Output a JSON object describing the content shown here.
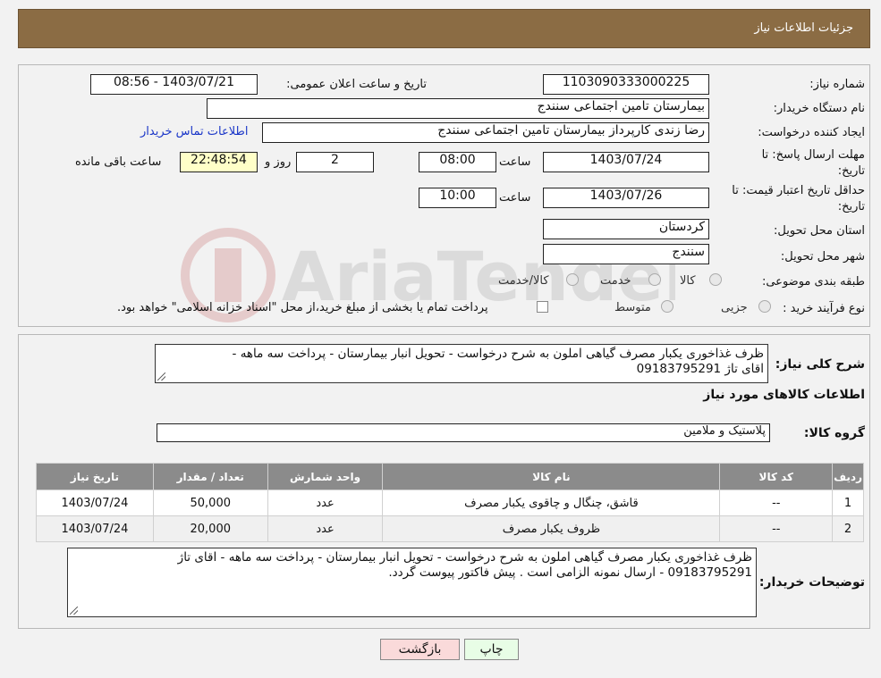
{
  "header": {
    "title": "جزئیات اطلاعات نیاز"
  },
  "form": {
    "need_number_label": "شماره نیاز:",
    "need_number": "1103090333000225",
    "announce_label": "تاریخ و ساعت اعلان عمومی:",
    "announce_value": "1403/07/21 - 08:56",
    "buyer_org_label": "نام دستگاه خریدار:",
    "buyer_org": "بیمارستان تامین اجتماعی سنندج",
    "creator_label": "ایجاد کننده درخواست:",
    "creator": "رضا زندی کارپرداز بیمارستان تامین اجتماعی سنندج",
    "contact_link": "اطلاعات تماس خریدار",
    "deadline_label_1": "مهلت ارسال پاسخ: تا",
    "deadline_label_2": "تاریخ:",
    "deadline_date": "1403/07/24",
    "time_word": "ساعت",
    "deadline_time": "08:00",
    "days_value": "2",
    "days_word": "روز و",
    "remaining_time": "22:48:54",
    "remaining_word": "ساعت باقی مانده",
    "validity_label_1": "حداقل تاریخ اعتبار قیمت: تا",
    "validity_label_2": "تاریخ:",
    "validity_date": "1403/07/26",
    "validity_time": "10:00",
    "province_label": "استان محل تحویل:",
    "province": "کردستان",
    "city_label": "شهر محل تحویل:",
    "city": "سنندج",
    "category_label": "طبقه بندی موضوعی:",
    "category_options": [
      "کالا",
      "خدمت",
      "کالا/خدمت"
    ],
    "process_label": "نوع فرآیند خرید :",
    "process_options": [
      "جزیی",
      "متوسط"
    ],
    "payment_note": "پرداخت تمام یا بخشی از مبلغ خرید،از محل \"اسناد خزانه اسلامی\" خواهد بود."
  },
  "summary": {
    "desc_label": "شرح کلی نیاز:",
    "desc_line1": "ظرف غذاخوری یکبار مصرف گیاهی املون  به شرح درخواست  - تحویل انبار بیمارستان - پرداخت سه ماهه -",
    "desc_line2": "اقای تاژ 09183795291",
    "goods_info_title": "اطلاعات کالاهای مورد نیاز",
    "goods_group_label": "گروه کالا:",
    "goods_group": "پلاستیک و ملامین"
  },
  "table": {
    "headers": [
      "ردیف",
      "کد کالا",
      "نام کالا",
      "واحد شمارش",
      "تعداد / مقدار",
      "تاریخ نیاز"
    ],
    "rows": [
      [
        "1",
        "--",
        "قاشق، چنگال و چاقوی یکبار مصرف",
        "عدد",
        "50,000",
        "1403/07/24"
      ],
      [
        "2",
        "--",
        "ظروف یکبار مصرف",
        "عدد",
        "20,000",
        "1403/07/24"
      ]
    ]
  },
  "buyer_notes": {
    "label": "توضیحات خریدار:",
    "line1": "ظرف غذاخوری یکبار مصرف گیاهی املون  به شرح درخواست  - تحویل انبار بیمارستان - پرداخت سه ماهه - اقای تاژ",
    "line2": "09183795291 - ارسال نمونه الزامی است . پیش فاکتور پیوست گردد."
  },
  "buttons": {
    "print": "چاپ",
    "back": "بازگشت"
  },
  "watermark_text": "AriaTender.neT",
  "colors": {
    "header_bg": "#8b6c44",
    "table_header_bg": "#8b8b8b",
    "back_button_bg": "#fadada",
    "print_button_bg": "#e8fde6"
  }
}
